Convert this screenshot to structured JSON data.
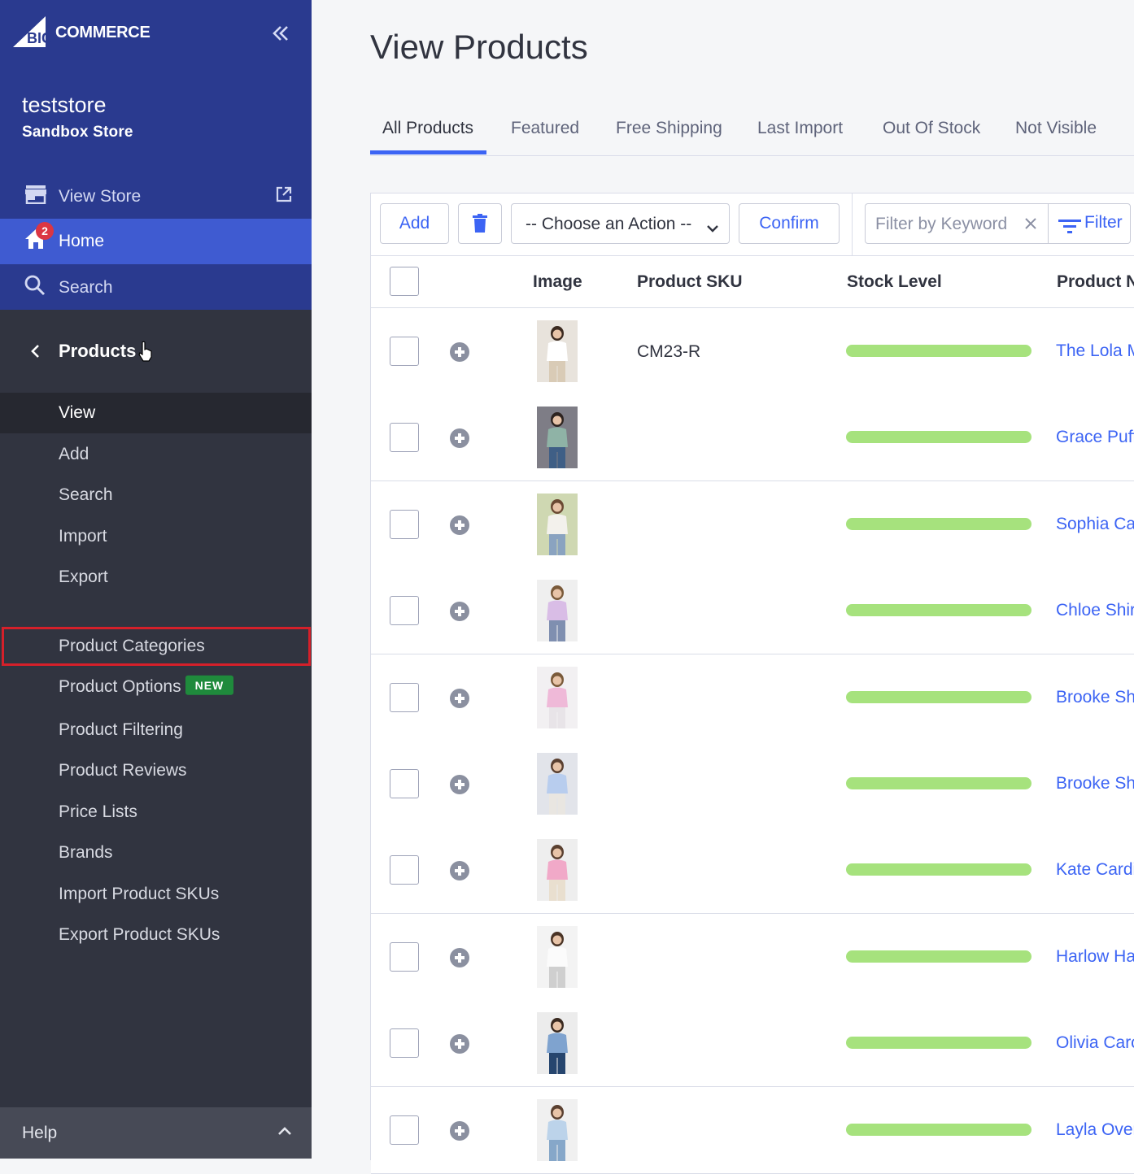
{
  "brand": {
    "logo_big": "BIG",
    "logo_rest": "COMMERCE"
  },
  "store": {
    "name": "teststore",
    "subtitle": "Sandbox Store"
  },
  "nav": {
    "view_store": "View Store",
    "home": "Home",
    "home_badge": "2",
    "search": "Search"
  },
  "products_menu": {
    "title": "Products",
    "items": [
      {
        "label": "View",
        "active": true
      },
      {
        "label": "Add"
      },
      {
        "label": "Search"
      },
      {
        "label": "Import"
      },
      {
        "label": "Export"
      },
      {
        "label": "Product Categories",
        "highlighted": true
      },
      {
        "label": "Product Options",
        "badge": "NEW"
      },
      {
        "label": "Product Filtering"
      },
      {
        "label": "Product Reviews"
      },
      {
        "label": "Price Lists"
      },
      {
        "label": "Brands"
      },
      {
        "label": "Import Product SKUs"
      },
      {
        "label": "Export Product SKUs"
      }
    ]
  },
  "help": {
    "label": "Help"
  },
  "page": {
    "title": "View Products"
  },
  "tabs": [
    "All Products",
    "Featured",
    "Free Shipping",
    "Last Import",
    "Out Of Stock",
    "Not Visible"
  ],
  "toolbar": {
    "add": "Add",
    "action_select": "-- Choose an Action --",
    "confirm": "Confirm",
    "filter_placeholder": "Filter by Keyword",
    "filter": "Filter"
  },
  "table": {
    "columns": [
      "Image",
      "Product SKU",
      "Stock Level",
      "Product N"
    ],
    "rows": [
      {
        "sku": "CM23-R",
        "name": "The Lola M",
        "stock": 1.0,
        "image": "product-photo-white-top"
      },
      {
        "sku": "",
        "name": "Grace Puff",
        "stock": 1.0,
        "image": "product-photo-green-top"
      },
      {
        "sku": "",
        "name": "Sophia Ca",
        "stock": 1.0,
        "image": "product-photo-striped-sweater"
      },
      {
        "sku": "",
        "name": "Chloe Shir",
        "stock": 1.0,
        "image": "product-photo-lilac-shirt"
      },
      {
        "sku": "",
        "name": "Brooke Sh",
        "stock": 1.0,
        "image": "product-photo-pink-shirt"
      },
      {
        "sku": "",
        "name": "Brooke Sh",
        "stock": 1.0,
        "image": "product-photo-blue-shirt"
      },
      {
        "sku": "",
        "name": "Kate Cardi",
        "stock": 1.0,
        "image": "product-photo-pink-cardigan"
      },
      {
        "sku": "",
        "name": "Harlow Ha",
        "stock": 1.0,
        "image": "product-photo-white-blouse"
      },
      {
        "sku": "",
        "name": "Olivia Carc",
        "stock": 1.0,
        "image": "product-photo-denim-top"
      },
      {
        "sku": "",
        "name": "Layla Over",
        "stock": 1.0,
        "image": "product-photo-light-blue-shirt"
      }
    ]
  },
  "colors": {
    "sidebar_top": "#2a3a8f",
    "sidebar_active": "#3f5bd1",
    "sidebar_dark": "#313440",
    "accent": "#3c64f4",
    "stock_bar": "#a6e27d",
    "badge_red": "#db3643",
    "new_badge": "#1f8a3c",
    "highlight_box": "#d5202a"
  }
}
